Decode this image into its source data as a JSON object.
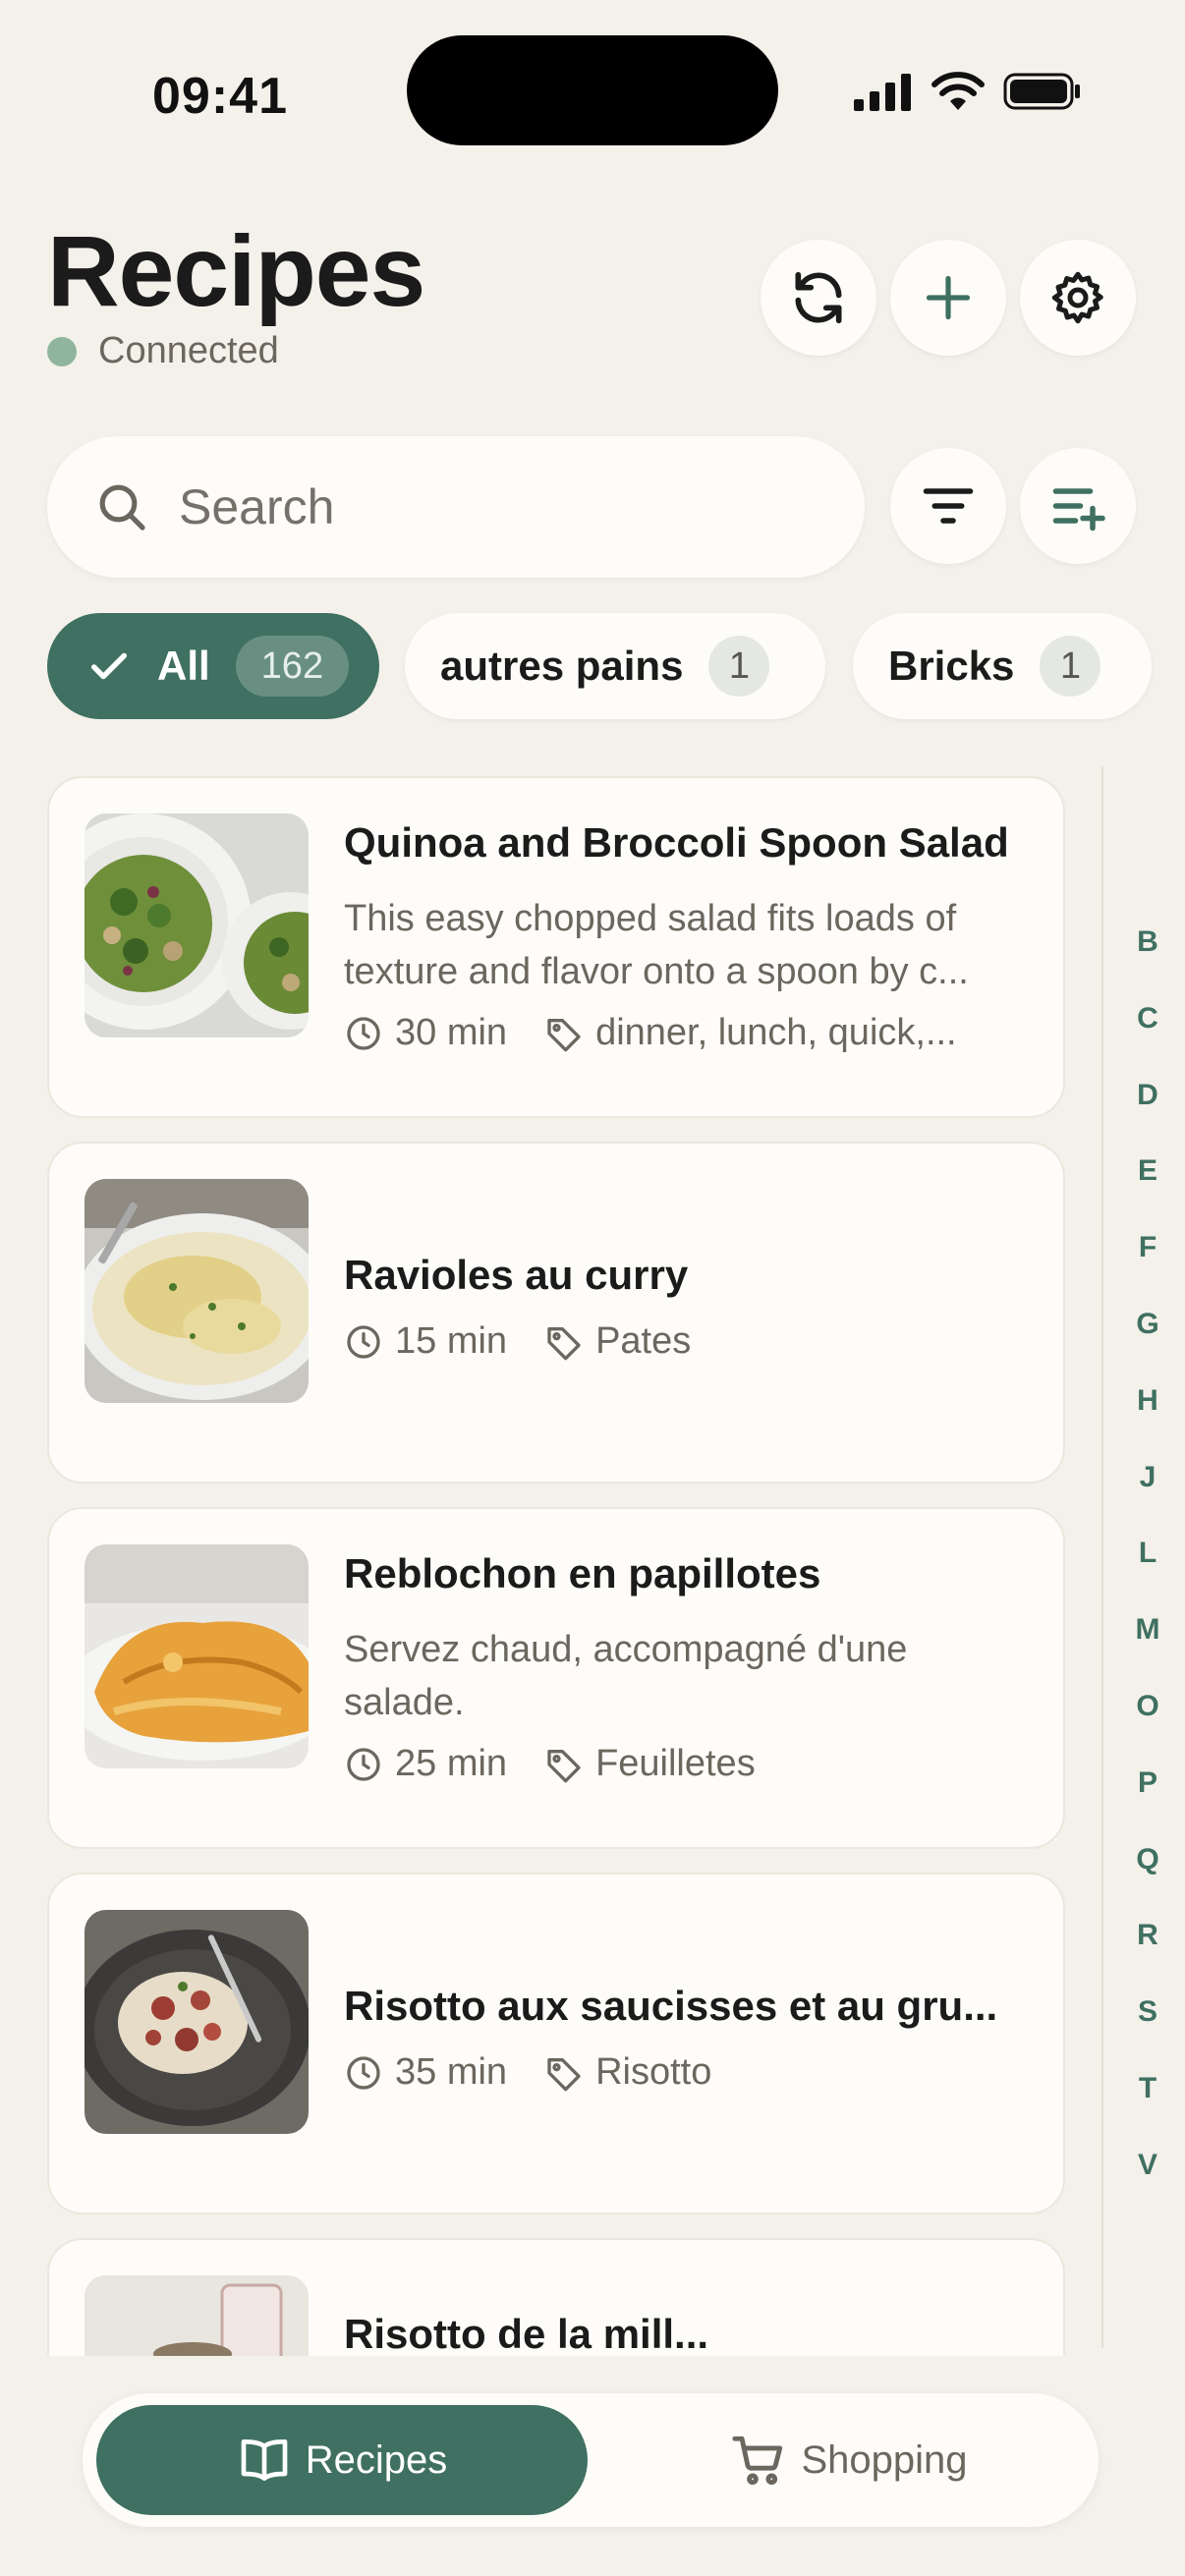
{
  "status_bar": {
    "time": "09:41"
  },
  "header": {
    "title": "Recipes",
    "connection_status": "Connected",
    "connection_color": "#8fb59c",
    "actions": [
      "refresh-icon",
      "plus-icon",
      "gear-icon"
    ]
  },
  "search": {
    "placeholder": "Search",
    "value": ""
  },
  "toolbar": {
    "filter_icon": "filter-icon",
    "sort_icon": "list-add-icon"
  },
  "chips": [
    {
      "label": "All",
      "count": "162",
      "selected": true
    },
    {
      "label": "autres pains",
      "count": "1",
      "selected": false
    },
    {
      "label": "Bricks",
      "count": "1",
      "selected": false
    }
  ],
  "recipes": [
    {
      "title": "Quinoa and Broccoli Spoon Salad",
      "description": "This easy chopped salad fits loads of texture and flavor onto a spoon by c...",
      "time": "30 min",
      "tags": "dinner, lunch, quick,..."
    },
    {
      "title": "Ravioles au curry",
      "description": "",
      "time": "15 min",
      "tags": "Pates"
    },
    {
      "title": "Reblochon en papillotes",
      "description": "Servez chaud, accompagné d'une salade.",
      "time": "25 min",
      "tags": "Feuilletes"
    },
    {
      "title": "Risotto aux saucisses et au gru...",
      "description": "",
      "time": "35 min",
      "tags": "Risotto"
    },
    {
      "title": "Risotto de la mill...",
      "description": "",
      "time": "",
      "tags": ""
    }
  ],
  "alphabet_index": [
    "B",
    "C",
    "D",
    "E",
    "F",
    "G",
    "H",
    "J",
    "L",
    "M",
    "O",
    "P",
    "Q",
    "R",
    "S",
    "T",
    "V"
  ],
  "tabs": [
    {
      "label": "Recipes",
      "icon": "book-icon",
      "active": true
    },
    {
      "label": "Shopping",
      "icon": "cart-icon",
      "active": false
    }
  ],
  "colors": {
    "accent": "#3f7061",
    "background": "#f4f1ea",
    "card": "#fdfcf9"
  }
}
